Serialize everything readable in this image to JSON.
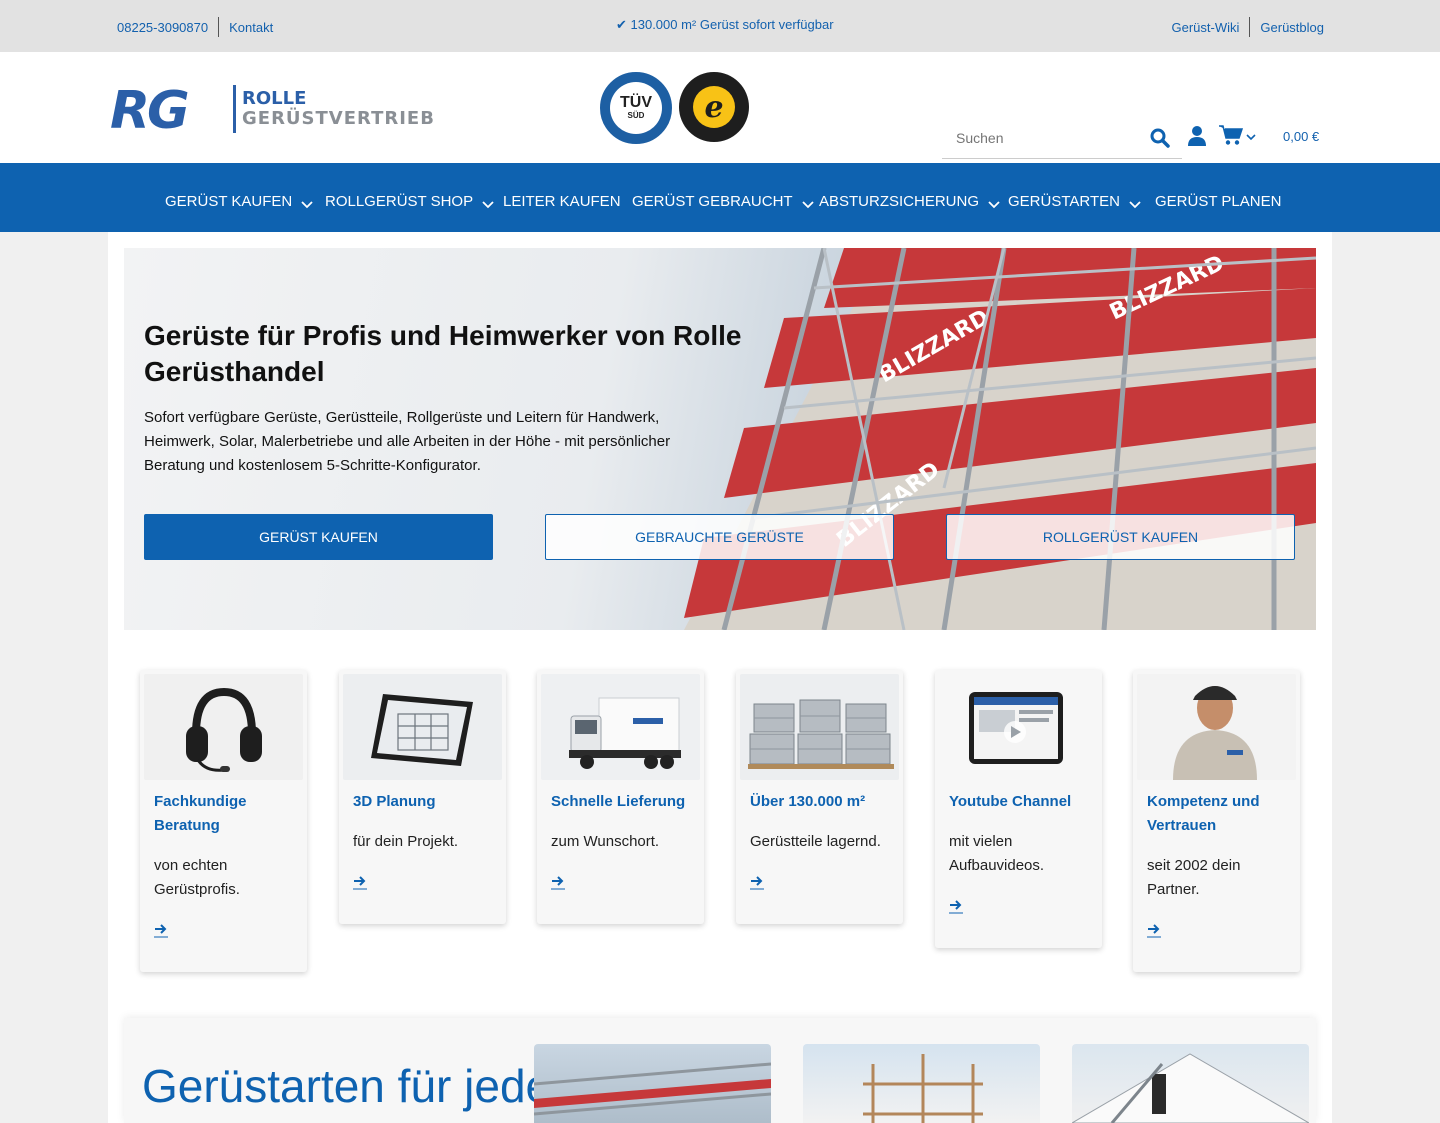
{
  "topbar": {
    "phone": "08225-3090870",
    "contact": "Kontakt",
    "promo": "✔ 130.000 m² Gerüst sofort verfügbar",
    "wiki": "Gerüst-Wiki",
    "blog": "Gerüstblog"
  },
  "header": {
    "logo_rg": "RG",
    "logo_line1": "ROLLE",
    "logo_line2": "GERÜSTVERTRIEB",
    "tuv_label": "TÜV",
    "tuv_sub": "SÜD",
    "trusted_label": "e",
    "search_placeholder": "Suchen",
    "cart_total": "0,00 €"
  },
  "nav": {
    "items": [
      {
        "label": "GERÜST KAUFEN",
        "dropdown": true
      },
      {
        "label": "ROLLGERÜST SHOP",
        "dropdown": true
      },
      {
        "label": "LEITER KAUFEN",
        "dropdown": false
      },
      {
        "label": "GERÜST GEBRAUCHT",
        "dropdown": true
      },
      {
        "label": "ABSTURZSICHERUNG",
        "dropdown": true
      },
      {
        "label": "GERÜSTARTEN",
        "dropdown": true
      },
      {
        "label": "GERÜST PLANEN",
        "dropdown": false
      }
    ]
  },
  "hero": {
    "title": "Gerüste für Profis und Heimwerker von Rolle Gerüsthandel",
    "text": "Sofort verfügbare Gerüste, Gerüstteile, Rollgerüste und Leitern für Handwerk, Heimwerk, Solar, Malerbetriebe und alle Arbeiten in der Höhe - mit persönlicher Beratung und kostenlosem 5-Schritte-Konfigurator.",
    "buttons": [
      "Gerüst kaufen",
      "Gebrauchte Gerüste",
      "Rollgerüst kaufen"
    ],
    "banner_text": "BLIZZARD"
  },
  "cards": [
    {
      "title": "Fachkundige Beratung",
      "desc": "von echten Gerüstprofis.",
      "icon": "headset"
    },
    {
      "title": "3D Planung",
      "desc": "für dein Projekt.",
      "icon": "tablet"
    },
    {
      "title": "Schnelle Lieferung",
      "desc": "zum Wunschort.",
      "icon": "truck"
    },
    {
      "title": "Über 130.000 m²",
      "desc": "Gerüstteile lagernd.",
      "icon": "pallets"
    },
    {
      "title": "Youtube Channel",
      "desc": "mit vielen Aufbauvideos.",
      "icon": "video-tablet"
    },
    {
      "title": "Kompetenz und Vertrauen",
      "desc": "seit 2002 dein Partner.",
      "icon": "person"
    }
  ],
  "section": {
    "heading": "Gerüstarten für jeden Einsatz"
  },
  "colors": {
    "brand_blue": "#0e62b0",
    "topbar_bg": "#e2e2e2",
    "banner_red": "#c6383a"
  }
}
